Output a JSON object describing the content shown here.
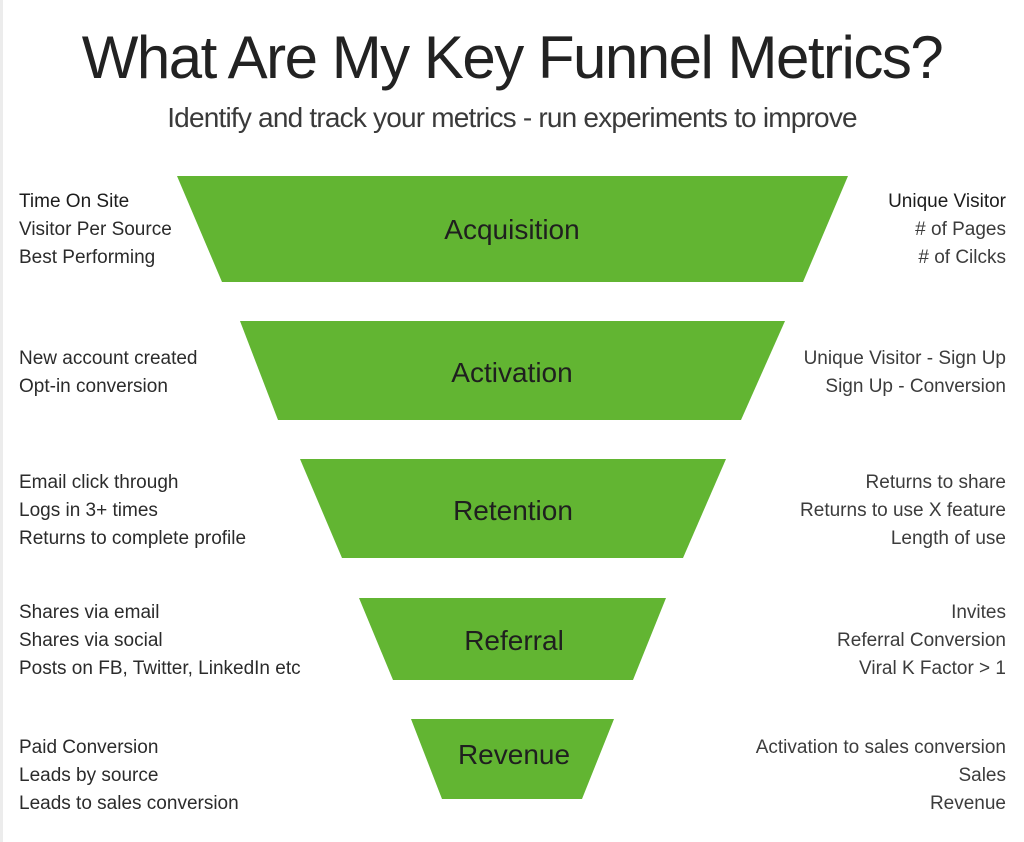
{
  "header": {
    "title": "What Are My Key Funnel Metrics?",
    "subtitle": "Identify and track your metrics - run experiments to improve"
  },
  "colors": {
    "funnel_fill": "#62B532",
    "text": "#222222"
  },
  "stages": [
    {
      "name": "Acquisition",
      "left_metrics": [
        "Time On Site",
        "Visitor Per Source",
        "Best Performing"
      ],
      "right_metrics": [
        "Unique Visitor",
        "# of Pages",
        "# of Cilcks"
      ]
    },
    {
      "name": "Activation",
      "left_metrics": [
        "New account created",
        "Opt-in conversion"
      ],
      "right_metrics": [
        "Unique Visitor - Sign Up",
        "Sign Up - Conversion"
      ]
    },
    {
      "name": "Retention",
      "left_metrics": [
        "Email click through",
        "Logs in 3+ times",
        "Returns to complete profile"
      ],
      "right_metrics": [
        "Returns to share",
        "Returns to use X feature",
        "Length of use"
      ]
    },
    {
      "name": "Referral",
      "left_metrics": [
        "Shares via email",
        "Shares via social",
        "Posts on FB, Twitter, LinkedIn etc"
      ],
      "right_metrics": [
        "Invites",
        "Referral Conversion",
        "Viral K Factor > 1"
      ]
    },
    {
      "name": "Revenue",
      "left_metrics": [
        "Paid Conversion",
        "Leads by source",
        "Leads to sales conversion"
      ],
      "right_metrics": [
        "Activation to sales conversion",
        "Sales",
        "Revenue"
      ]
    }
  ]
}
